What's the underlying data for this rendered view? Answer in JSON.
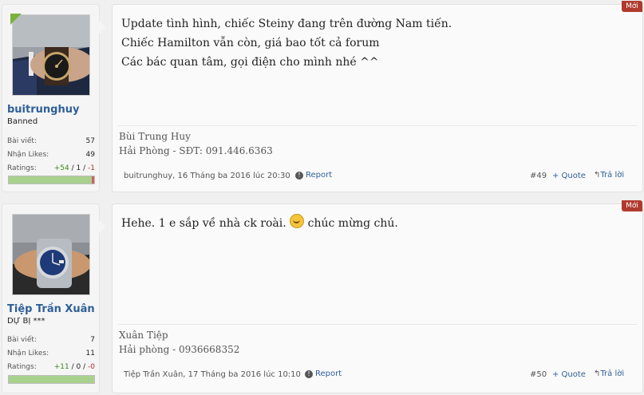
{
  "posts": [
    {
      "badge": "Mới",
      "author": {
        "name": "buitrunghuy",
        "title": "Banned",
        "stats": [
          {
            "label": "Bài viết:",
            "value": "57"
          },
          {
            "label": "Nhận Likes:",
            "value": "49"
          }
        ],
        "ratings_label": "Ratings:",
        "ratings": {
          "positive": "+54",
          "neutral": "1",
          "negative": "-1",
          "sep": "/"
        }
      },
      "message": [
        "Update tình hình, chiếc Steiny đang trên đường Nam tiến.",
        "Chiếc Hamilton vẫn còn, giá bao tốt cả forum",
        "Các bác quan tâm, gọi điện cho mình nhé ^^"
      ],
      "signature": [
        "Bùi Trung Huy",
        "Hải Phòng - SĐT: 091.446.6363"
      ],
      "meta": "buitrunghuy, 16 Tháng ba 2016 lúc 20:30",
      "report": "Report",
      "number": "#49",
      "quote": "+ Quote",
      "reply": "Trả lời"
    },
    {
      "badge": "Mới",
      "author": {
        "name": "Tiệp Trần Xuân",
        "title": "DỰ BỊ ***",
        "stats": [
          {
            "label": "Bài viết:",
            "value": "7"
          },
          {
            "label": "Nhận Likes:",
            "value": "11"
          }
        ],
        "ratings_label": "Ratings:",
        "ratings": {
          "positive": "+11",
          "neutral": "0",
          "negative": "-0",
          "sep": "/"
        }
      },
      "message": {
        "before": "Hehe. 1 e sắp về nhà ck roài.",
        "after": "chúc mừng chú."
      },
      "signature": [
        "Xuân Tiệp",
        "Hải phòng - 0936668352"
      ],
      "meta": "Tiệp Trần Xuân, 17 Tháng ba 2016 lúc 10:10",
      "report": "Report",
      "number": "#50",
      "quote": "+ Quote",
      "reply": "Trả lời"
    }
  ],
  "icons": {
    "report": "info-circle-icon",
    "reply": "reply-arrow-icon",
    "smiley": "smiley-icon"
  }
}
